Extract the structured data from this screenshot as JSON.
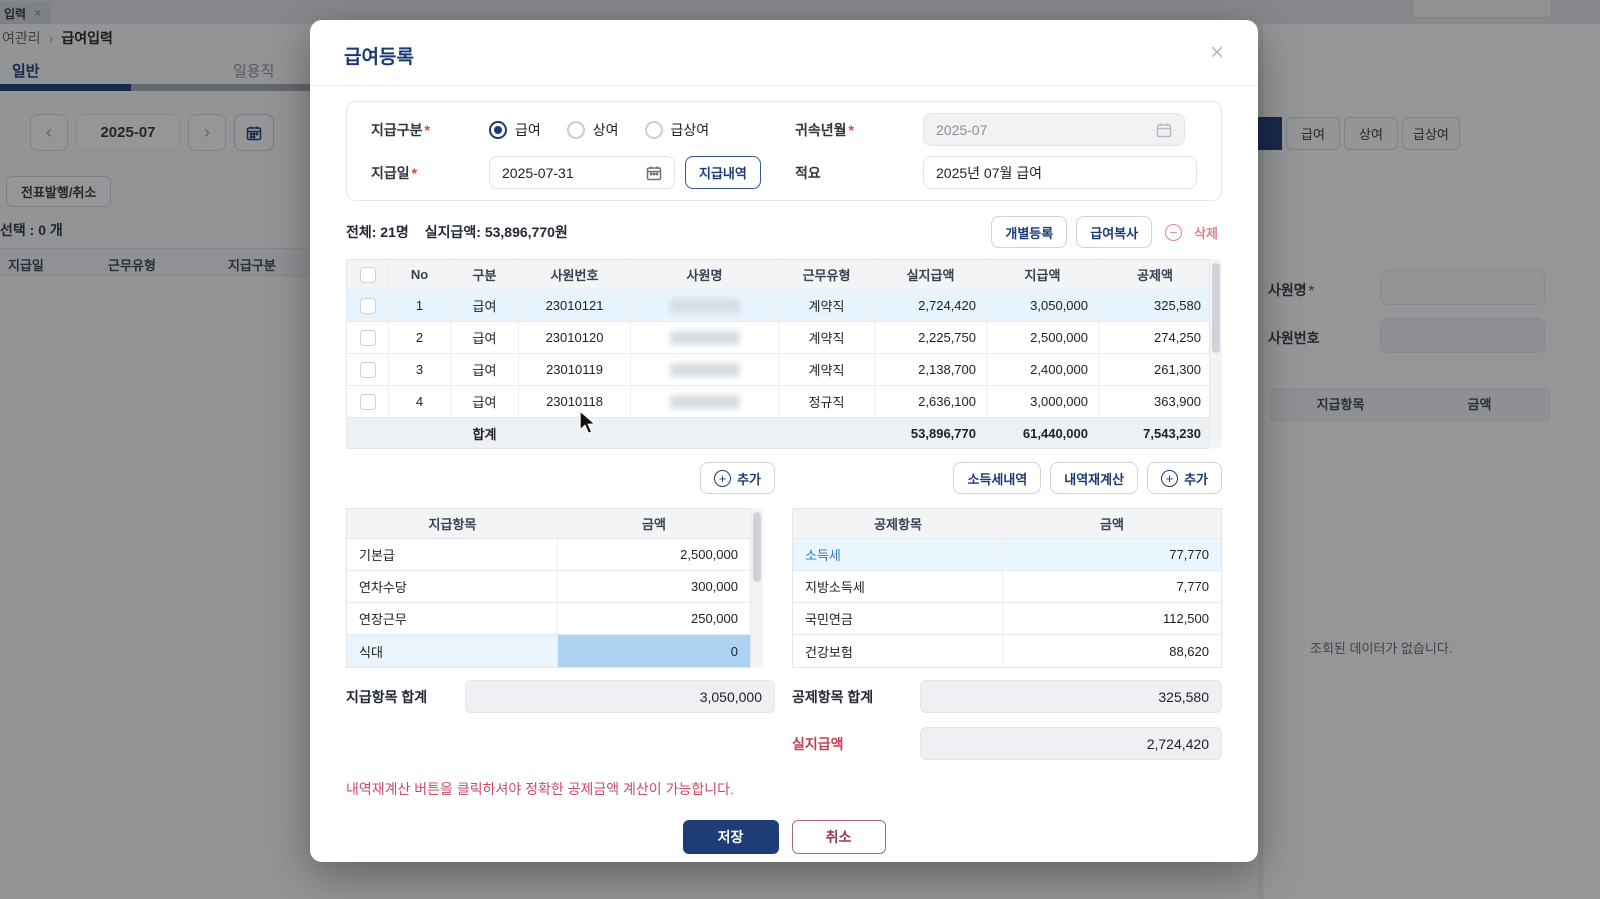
{
  "background": {
    "tab": {
      "label": "입력",
      "close": "×"
    },
    "breadcrumb": {
      "parent": "여관리",
      "separator": "›",
      "current": "급여입력"
    },
    "tabs": {
      "active": "일반",
      "inactive": "일용직"
    },
    "date_nav": {
      "prev": "‹",
      "value": "2025-07",
      "next": "›"
    },
    "voucher_button": "전표발행/취소",
    "selection_text": "선택 : 0 개",
    "left_table_headers": {
      "col1": "지급일",
      "col2": "근무유형",
      "col3": "지급구분"
    },
    "filter_buttons": {
      "b1": "급여",
      "b2": "상여",
      "b3": "급상여"
    },
    "emp_name_label": "사원명",
    "emp_no_label": "사원번호",
    "right_table_headers": {
      "col1": "지급항목",
      "col2": "금액"
    },
    "empty_text": "조회된 데이터가 없습니다."
  },
  "modal": {
    "title": "급여등록",
    "close": "×",
    "form": {
      "pay_type_label": "지급구분",
      "radio1": "급여",
      "radio2": "상여",
      "radio3": "급상여",
      "month_label": "귀속년월",
      "month_value": "2025-07",
      "date_label": "지급일",
      "date_value": "2025-07-31",
      "pay_detail_button": "지급내역",
      "memo_label": "적요",
      "memo_value": "2025년 07월 급여"
    },
    "summary": {
      "count": "전체: 21명",
      "net": "실지급액: 53,896,770원",
      "individual_button": "개별등록",
      "copy_button": "급여복사",
      "delete_button": "삭제"
    },
    "employee_table": {
      "headers": {
        "no": "No",
        "type": "구분",
        "emp_no": "사원번호",
        "emp_name": "사원명",
        "work": "근무유형",
        "net": "실지급액",
        "pay": "지급액",
        "deduct": "공제액"
      },
      "rows": [
        {
          "no": "1",
          "type": "급여",
          "emp_no": "23010121",
          "work": "계약직",
          "net": "2,724,420",
          "pay": "3,050,000",
          "deduct": "325,580"
        },
        {
          "no": "2",
          "type": "급여",
          "emp_no": "23010120",
          "work": "계약직",
          "net": "2,225,750",
          "pay": "2,500,000",
          "deduct": "274,250"
        },
        {
          "no": "3",
          "type": "급여",
          "emp_no": "23010119",
          "work": "계약직",
          "net": "2,138,700",
          "pay": "2,400,000",
          "deduct": "261,300"
        },
        {
          "no": "4",
          "type": "급여",
          "emp_no": "23010118",
          "work": "정규직",
          "net": "2,636,100",
          "pay": "3,000,000",
          "deduct": "363,900"
        }
      ],
      "total": {
        "label": "합계",
        "net": "53,896,770",
        "pay": "61,440,000",
        "deduct": "7,543,230"
      }
    },
    "mid_buttons": {
      "add_left": "추가",
      "income_tax": "소득세내역",
      "recalc": "내역재계산",
      "add_right": "추가"
    },
    "pay_items": {
      "headers": {
        "col1": "지급항목",
        "col2": "금액"
      },
      "rows": [
        {
          "label": "기본급",
          "amount": "2,500,000"
        },
        {
          "label": "연차수당",
          "amount": "300,000"
        },
        {
          "label": "연장근무",
          "amount": "250,000"
        },
        {
          "label": "식대",
          "amount": "0"
        }
      ]
    },
    "deduct_items": {
      "headers": {
        "col1": "공제항목",
        "col2": "금액"
      },
      "rows": [
        {
          "label": "소득세",
          "amount": "77,770"
        },
        {
          "label": "지방소득세",
          "amount": "7,770"
        },
        {
          "label": "국민연금",
          "amount": "112,500"
        },
        {
          "label": "건강보험",
          "amount": "88,620"
        }
      ]
    },
    "totals": {
      "pay_total_label": "지급항목 합계",
      "pay_total_value": "3,050,000",
      "deduct_total_label": "공제항목 합계",
      "deduct_total_value": "325,580",
      "net_label": "실지급액",
      "net_value": "2,724,420"
    },
    "warning": "내역재계산 버튼을 클릭하셔야 정확한 공제금액 계산이 가능합니다.",
    "save_button": "저장",
    "cancel_button": "취소"
  },
  "colors": {
    "accent_navy": "#1b3a75",
    "row_highlight": "#e7f3fd",
    "selected_cell": "#aed3f2",
    "danger_red": "#cc4b63"
  }
}
